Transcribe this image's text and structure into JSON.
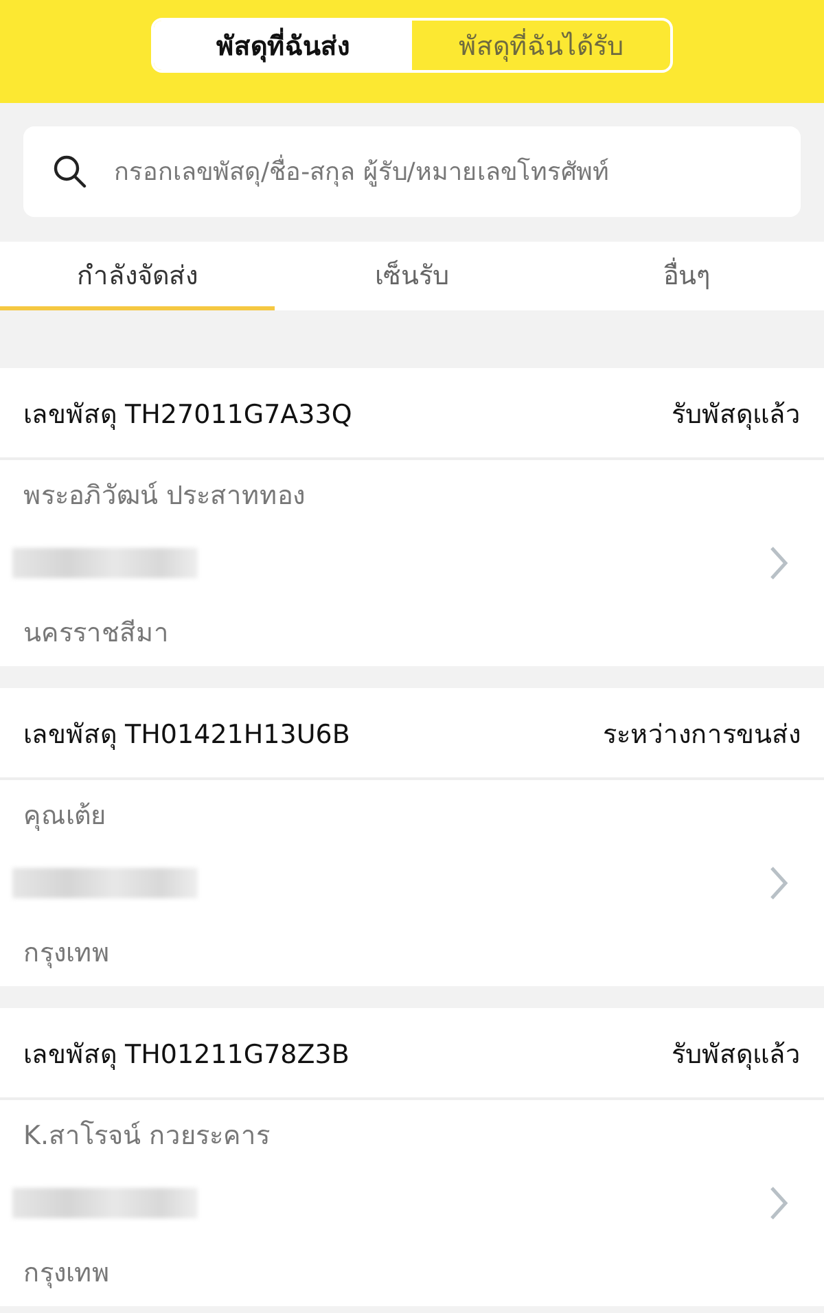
{
  "segments": [
    {
      "label": "พัสดุที่ฉันส่ง",
      "selected": true
    },
    {
      "label": "พัสดุที่ฉันได้รับ",
      "selected": false
    }
  ],
  "search": {
    "placeholder": "กรอกเลขพัสดุ/ชื่อ-สกุล ผู้รับ/หมายเลขโทรศัพท์"
  },
  "tabs": [
    {
      "label": "กำลังจัดส่ง",
      "selected": true
    },
    {
      "label": "เซ็นรับ",
      "selected": false
    },
    {
      "label": "อื่นๆ",
      "selected": false
    }
  ],
  "parcels": [
    {
      "tracking": "เลขพัสดุ TH27011G7A33Q",
      "status": "รับพัสดุแล้ว",
      "recipient": "พระอภิวัฒน์ ประสาททอง",
      "province": "นครราชสีมา"
    },
    {
      "tracking": "เลขพัสดุ TH01421H13U6B",
      "status": "ระหว่างการขนส่ง",
      "recipient": "คุณเต้ย",
      "province": "กรุงเทพ"
    },
    {
      "tracking": "เลขพัสดุ TH01211G78Z3B",
      "status": "รับพัสดุแล้ว",
      "recipient": "K.สาโรจน์ กวยระคาร",
      "province": "กรุงเทพ"
    }
  ]
}
